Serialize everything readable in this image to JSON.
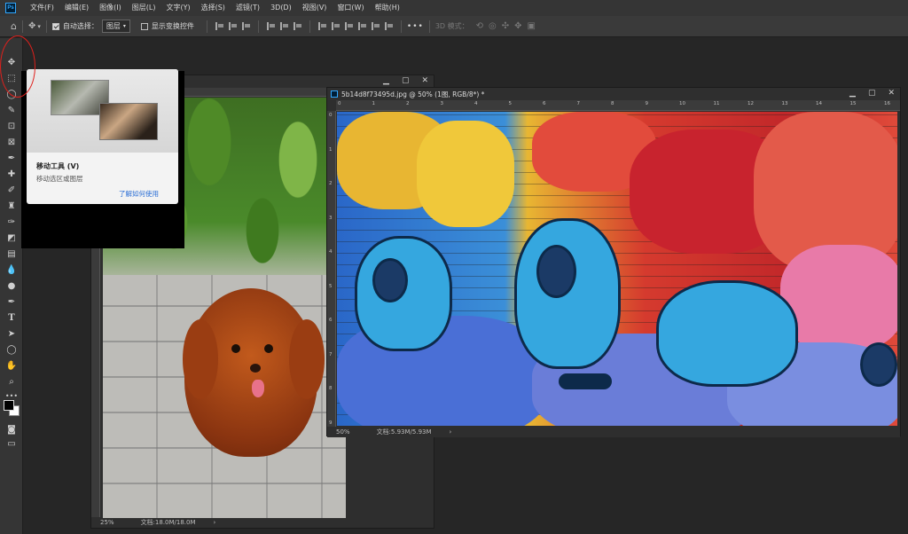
{
  "app": {
    "logo": "Ps"
  },
  "menu": [
    "文件(F)",
    "编辑(E)",
    "图像(I)",
    "图层(L)",
    "文字(Y)",
    "选择(S)",
    "滤镜(T)",
    "3D(D)",
    "视图(V)",
    "窗口(W)",
    "帮助(H)"
  ],
  "options": {
    "auto_select_label": "自动选择：",
    "auto_select_checked": true,
    "layer_select_value": "图层",
    "show_transform_label": "显示变换控件",
    "more": "•••",
    "mode_3d_label": "3D 模式："
  },
  "tooltip": {
    "title": "移动工具 (V)",
    "description": "移动选区或图层",
    "learn_more": "了解如何使用"
  },
  "doc_left": {
    "zoom": "25%",
    "doc_size": "文档:18.0M/18.0M"
  },
  "doc_right": {
    "title": "5b14d8f73495d.jpg @ 50% (1图, RGB/8*) *",
    "zoom": "50%",
    "doc_size": "文档:5.93M/5.93M",
    "ruler_h": [
      "0",
      "1",
      "2",
      "3",
      "4",
      "5",
      "6",
      "7",
      "8",
      "9",
      "10",
      "11",
      "12",
      "13",
      "14",
      "15",
      "16"
    ],
    "ruler_v": [
      "0",
      "1",
      "2",
      "3",
      "4",
      "5",
      "6",
      "7",
      "8",
      "9"
    ]
  },
  "colors": {
    "foreground": "#000000",
    "background": "#ffffff",
    "annotation": "#e0201c"
  }
}
